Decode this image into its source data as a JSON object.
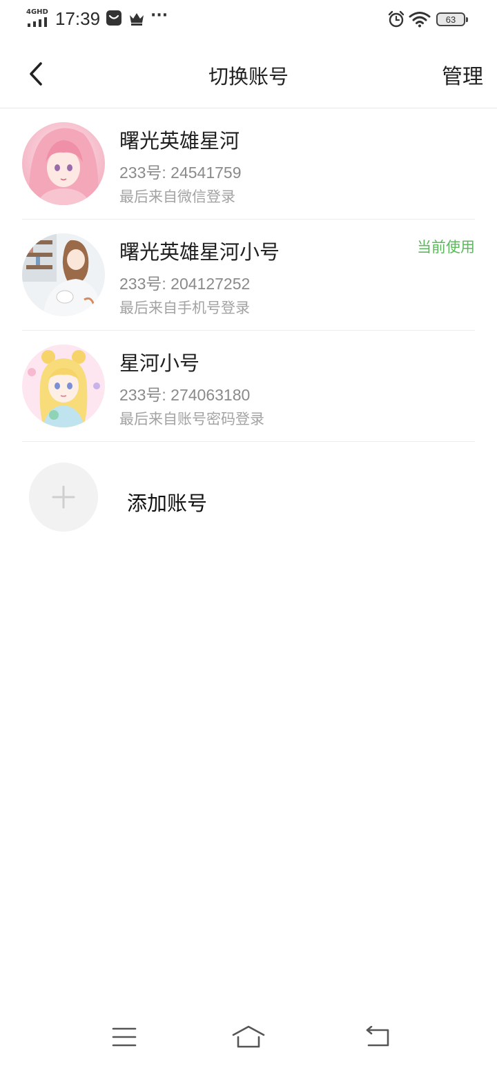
{
  "status_bar": {
    "network": "4GHD",
    "time": "17:39",
    "more": "···",
    "battery": "63",
    "icons": [
      "signal-icon",
      "notification-app-icon",
      "crown-icon",
      "alarm-icon",
      "wifi-icon",
      "battery-icon"
    ]
  },
  "header": {
    "title": "切换账号",
    "manage_label": "管理",
    "back_icon": "chevron-left-icon"
  },
  "accounts": [
    {
      "name": "曙光英雄星河",
      "id_text": "233号: 24541759",
      "login_text": "最后来自微信登录",
      "current_label": ""
    },
    {
      "name": "曙光英雄星河小号",
      "id_text": "233号: 204127252",
      "login_text": "最后来自手机号登录",
      "current_label": "当前使用"
    },
    {
      "name": "星河小号",
      "id_text": "233号: 274063180",
      "login_text": "最后来自账号密码登录",
      "current_label": ""
    }
  ],
  "add_account": {
    "label": "添加账号",
    "icon": "plus-icon"
  },
  "nav_bar": {
    "icons": [
      "menu-icon",
      "home-icon",
      "back-icon"
    ]
  },
  "colors": {
    "accent_current": "#5cb85c",
    "secondary_text": "#8a8a8a",
    "divider": "#ececec"
  }
}
